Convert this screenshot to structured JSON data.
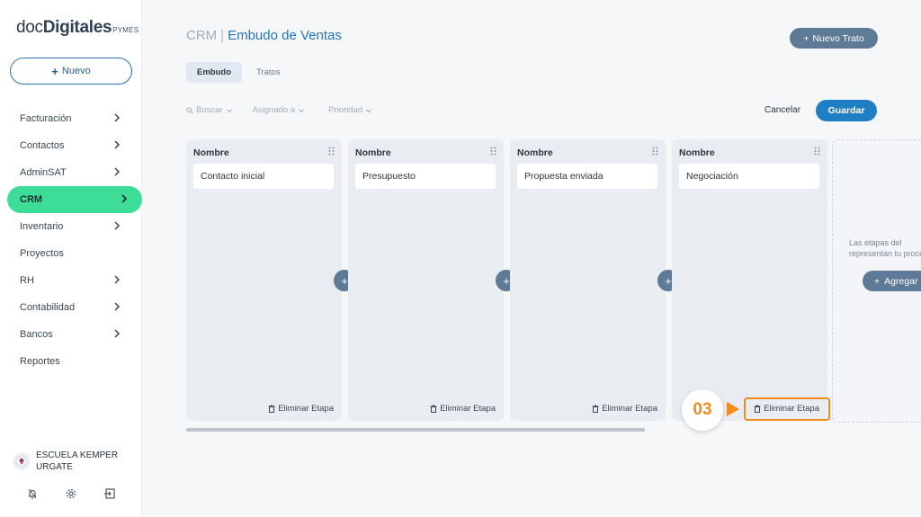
{
  "brand": {
    "part1": "doc",
    "part2": "Digitales",
    "suffix": "PYMES"
  },
  "sidebar": {
    "new_label": "Nuevo",
    "items": [
      {
        "label": "Facturación",
        "chevron": true
      },
      {
        "label": "Contactos",
        "chevron": true
      },
      {
        "label": "AdminSAT",
        "chevron": true
      },
      {
        "label": "CRM",
        "chevron": true,
        "active": true
      },
      {
        "label": "Inventario",
        "chevron": true
      },
      {
        "label": "Proyectos",
        "chevron": false
      },
      {
        "label": "RH",
        "chevron": true
      },
      {
        "label": "Contabilidad",
        "chevron": true
      },
      {
        "label": "Bancos",
        "chevron": true
      },
      {
        "label": "Reportes",
        "chevron": false
      }
    ],
    "user_line1": "ESCUELA KEMPER",
    "user_line2": "URGATE",
    "footer_icons": [
      "bell-icon",
      "gear-icon",
      "logout-icon"
    ]
  },
  "header": {
    "section": "CRM",
    "separator": "|",
    "title": "Embudo de Ventas",
    "new_deal_label": "Nuevo Trato"
  },
  "tabs": [
    {
      "label": "Embudo",
      "active": true
    },
    {
      "label": "Tratos",
      "active": false
    }
  ],
  "filters": {
    "search": "Buscar",
    "assigned": "Asignado a",
    "priority": "Prioridad"
  },
  "actions": {
    "cancel": "Cancelar",
    "save": "Guardar"
  },
  "board": {
    "column_header": "Nombre",
    "delete_label": "Eliminar Etapa",
    "stages": [
      "Contacto inicial",
      "Presupuesto",
      "Propuesta enviada",
      "Negociación"
    ],
    "ghost_text_line1": "Las etapas del",
    "ghost_text_line2": "representan tu proce",
    "ghost_button": "Agregar"
  },
  "annotation": {
    "step": "03",
    "color": "#f28a1c"
  },
  "colors": {
    "accent": "#1f7fc4",
    "active_nav": "#3ddc97",
    "slate_button": "#5f7a96"
  }
}
